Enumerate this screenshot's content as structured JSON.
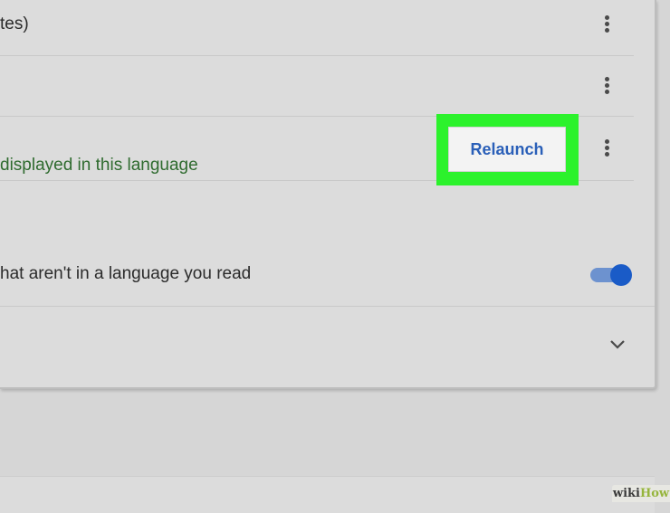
{
  "rows": [
    {
      "text": "tes)",
      "menu_icon": "more-vert-icon"
    },
    {
      "text": "",
      "menu_icon": "more-vert-icon"
    },
    {
      "status_text": "displayed in this language",
      "button_label": "Relaunch",
      "menu_icon": "more-vert-icon"
    }
  ],
  "translate_offer": {
    "label": "hat aren't in a language you read",
    "toggle_on": true
  },
  "expand_icon": "chevron-down-icon",
  "watermark": {
    "part1": "wiki",
    "part2": "How"
  },
  "colors": {
    "highlight": "#2cf22c",
    "button_text": "#2a5fb8",
    "status_text": "#2f6b2f",
    "toggle": "#1a5bc7"
  }
}
